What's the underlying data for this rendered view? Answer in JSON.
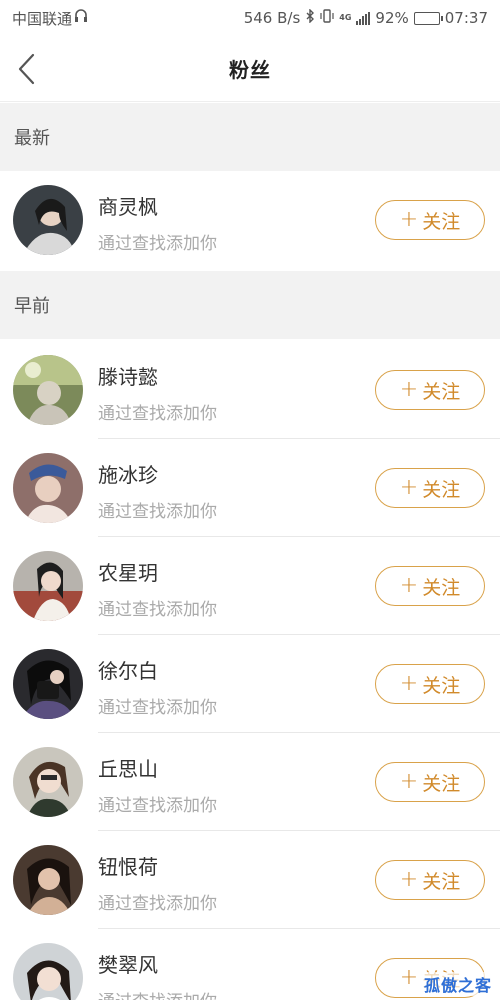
{
  "status_bar": {
    "carrier": "中国联通",
    "speed": "546 B/s",
    "battery": "92%",
    "battery_level": 0.92,
    "time": "07:37",
    "icons": [
      "hd-audio-icon",
      "bluetooth-icon",
      "vibrate-icon",
      "4g-icon",
      "signal-icon",
      "battery-icon"
    ]
  },
  "nav": {
    "title": "粉丝",
    "back_icon": "chevron-left-icon"
  },
  "sections": {
    "latest": "最新",
    "earlier": "早前"
  },
  "follow_label": "关注",
  "latest_users": [
    {
      "name": "商灵枫",
      "sub": "通过查找添加你"
    }
  ],
  "earlier_users": [
    {
      "name": "滕诗懿",
      "sub": "通过查找添加你"
    },
    {
      "name": "施冰珍",
      "sub": "通过查找添加你"
    },
    {
      "name": "农星玥",
      "sub": "通过查找添加你"
    },
    {
      "name": "徐尔白",
      "sub": "通过查找添加你"
    },
    {
      "name": "丘思山",
      "sub": "通过查找添加你"
    },
    {
      "name": "钮恨荷",
      "sub": "通过查找添加你"
    },
    {
      "name": "樊翠风",
      "sub": "通过查找添加你"
    }
  ],
  "watermark": "孤傲之客",
  "colors": {
    "accent": "#d18a2b",
    "section_bg": "#f2f2f2",
    "watermark": "#2f6fd6"
  }
}
